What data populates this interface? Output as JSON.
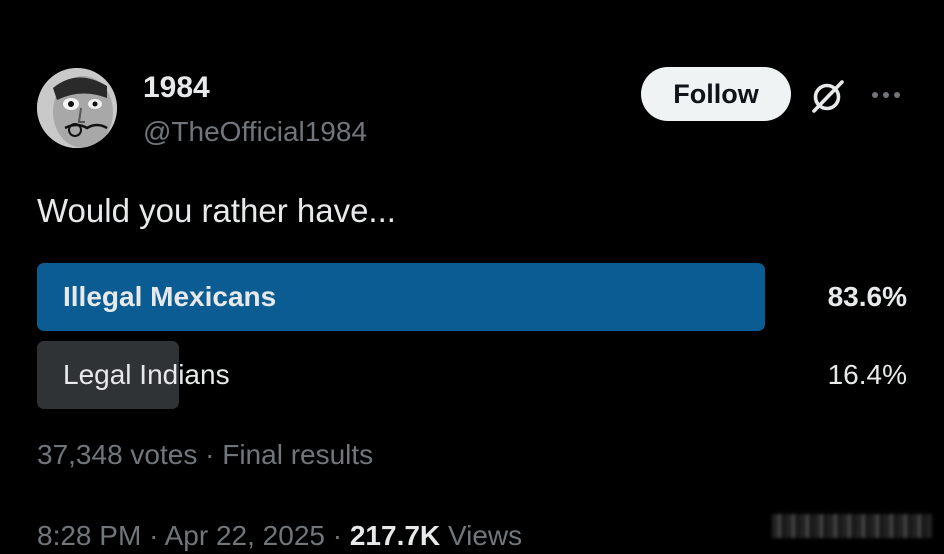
{
  "author": {
    "display_name": "1984",
    "handle": "@TheOfficial1984",
    "avatar_icon": "surreal-face-portrait"
  },
  "header": {
    "follow_label": "Follow",
    "grok_icon": "grok-slashed-circle-icon",
    "more_icon": "more-horizontal-icon"
  },
  "tweet": {
    "text": "Would you rather have..."
  },
  "poll": {
    "options": [
      {
        "label": "Illegal Mexicans",
        "percent_text": "83.6%",
        "percent": 83.6,
        "winner": true
      },
      {
        "label": "Legal Indians",
        "percent_text": "16.4%",
        "percent": 16.4,
        "winner": false
      }
    ],
    "votes": "37,348 votes",
    "separator": "·",
    "status": "Final results"
  },
  "meta": {
    "time": "8:28 PM",
    "separator": "·",
    "date": "Apr 22, 2025",
    "views_count": "217.7K",
    "views_label": "Views"
  },
  "colors": {
    "background": "#000000",
    "winner_bar": "#0b5c93",
    "loser_bar": "#2f3336",
    "secondary_text": "#71767b",
    "primary_text": "#e7e9ea"
  }
}
